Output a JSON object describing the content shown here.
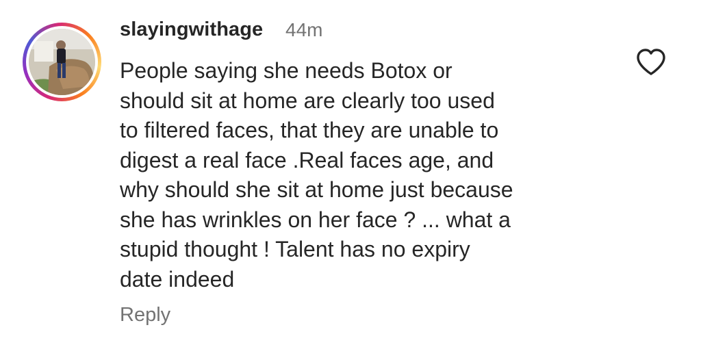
{
  "comment": {
    "username": "slayingwithage",
    "time": "44m",
    "text": "People saying she needs Botox or\nshould sit at home are clearly too used\nto filtered faces, that they are unable to\ndigest a real face .Real faces age, and\nwhy should she sit at home just because\nshe has wrinkles on her face ? ...  what a\nstupid thought ! Talent has no expiry\ndate indeed",
    "reply_label": "Reply",
    "like_icon": "heart-outline-icon",
    "avatar_ring_colors": [
      "#feda75",
      "#fa7e1e",
      "#d62976",
      "#962fbf",
      "#4f5bd5"
    ]
  }
}
